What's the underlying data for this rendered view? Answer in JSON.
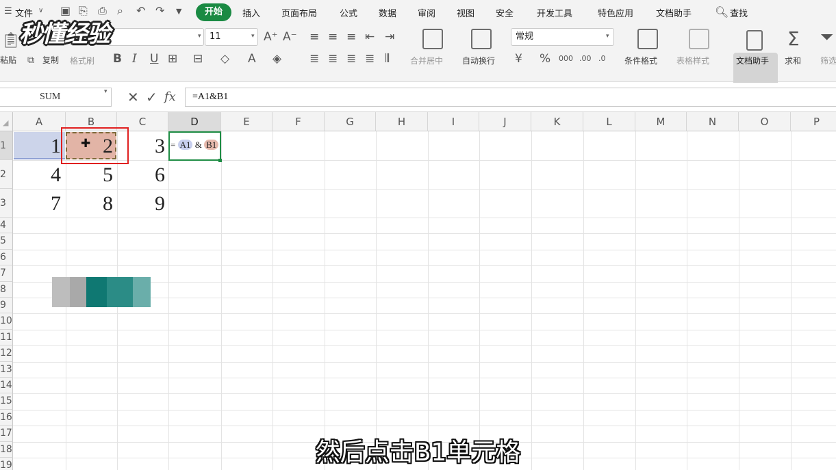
{
  "topbar": {
    "file_menu": "文件",
    "tabs": [
      "开始",
      "插入",
      "页面布局",
      "公式",
      "数据",
      "审阅",
      "视图",
      "安全",
      "开发工具",
      "特色应用",
      "文档助手"
    ],
    "search": "查找"
  },
  "ribbon": {
    "font_size": "11",
    "paste": "粘贴",
    "copy": "复制",
    "format_painter": "格式刷",
    "merge_center": "合并居中",
    "wrap_text": "自动换行",
    "number_format": "常规",
    "conditional_format": "条件格式",
    "table_style": "表格样式",
    "doc_assistant": "文档助手",
    "sum": "求和",
    "filter": "筛选"
  },
  "formula_bar": {
    "name_box": "SUM",
    "formula": "=A1&B1"
  },
  "sheet": {
    "columns": [
      "A",
      "B",
      "C",
      "D",
      "E",
      "F",
      "G",
      "H",
      "I",
      "J",
      "K",
      "L",
      "M",
      "N",
      "O",
      "P"
    ],
    "rows": [
      "1",
      "2",
      "3",
      "4",
      "5",
      "6",
      "7",
      "8",
      "9",
      "10",
      "11",
      "12",
      "13",
      "14",
      "15",
      "16",
      "17",
      "18",
      "19"
    ],
    "cells": {
      "A1": "1",
      "B1": "2",
      "C1": "3",
      "A2": "4",
      "B2": "5",
      "C2": "6",
      "A3": "7",
      "B3": "8",
      "C3": "9"
    },
    "d1_edit": {
      "eq": "=",
      "ref1": "A1",
      "op": "&",
      "ref2": "B1"
    }
  },
  "watermark": "秒懂经验",
  "subtitle": "然后点击B1单元格",
  "colors": {
    "accent": "#1a8a43",
    "selection_red": "#e02020"
  }
}
